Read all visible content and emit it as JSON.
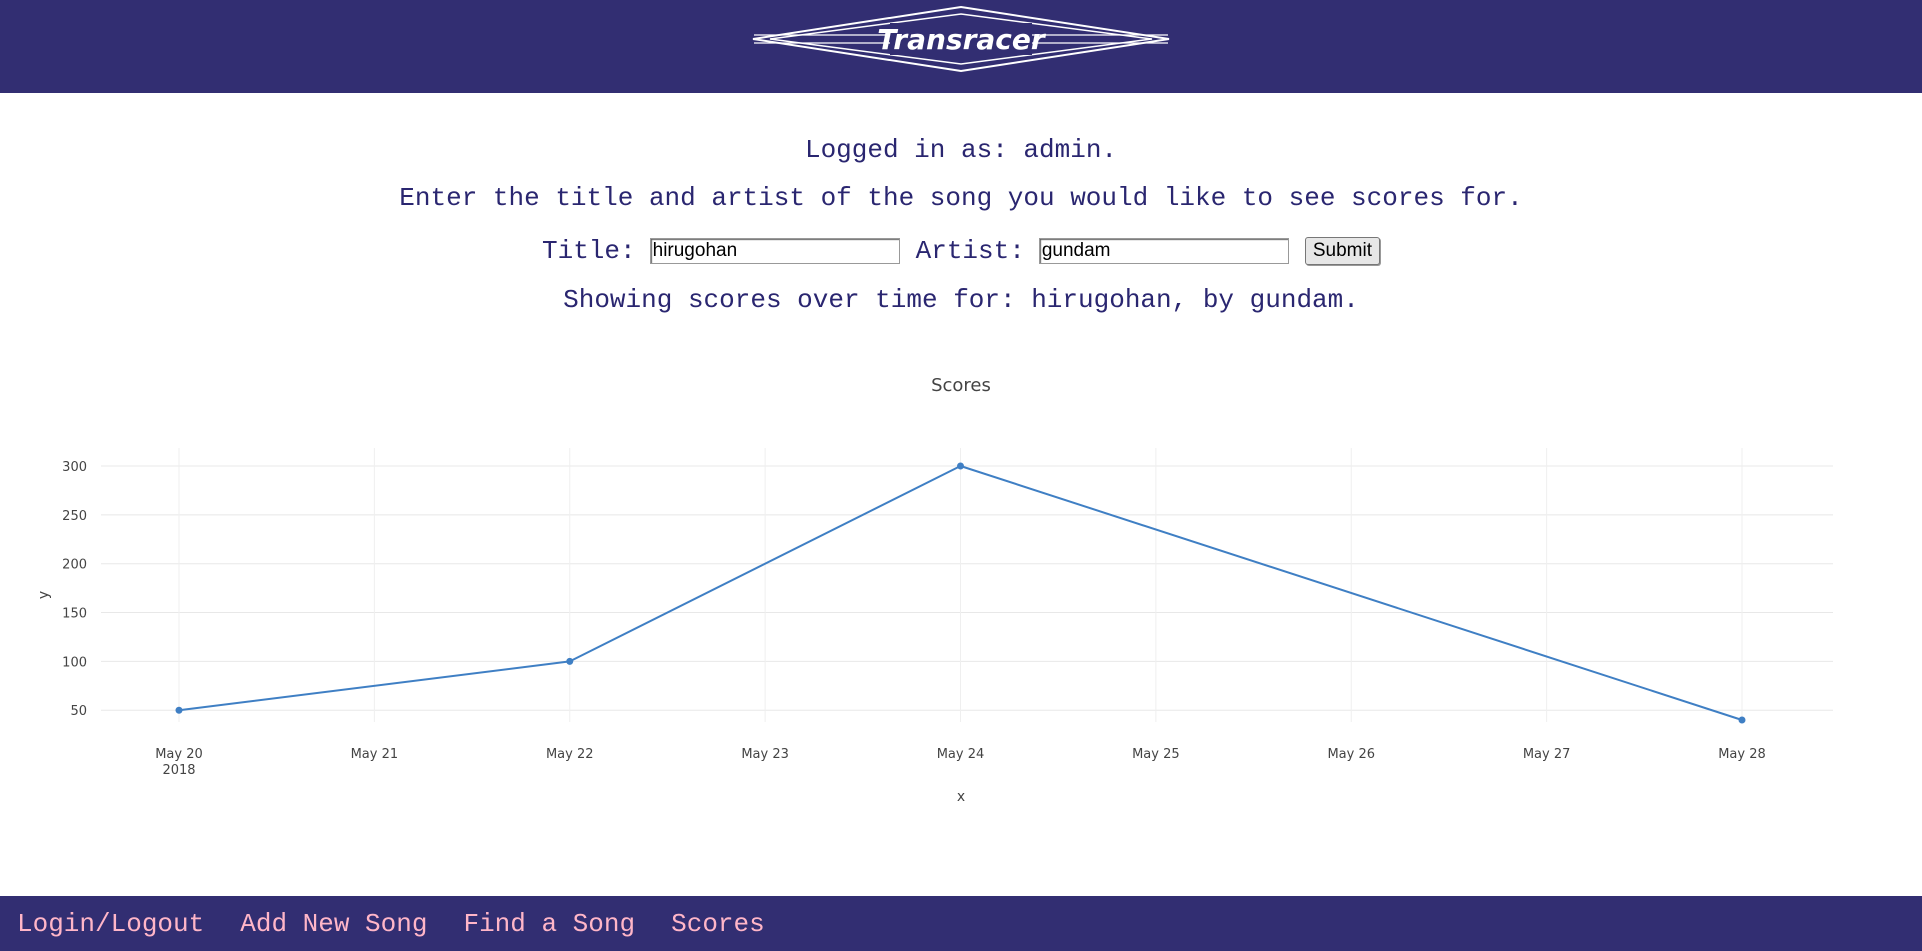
{
  "header": {
    "logo_text": "Transracer"
  },
  "status": {
    "logged_in_text": "Logged in as: admin.",
    "instruction": "Enter the title and artist of the song you would like to see scores for.",
    "showing_text": "Showing scores over time for: hirugohan, by gundam."
  },
  "form": {
    "title_label": "Title:",
    "title_value": "hirugohan",
    "artist_label": "Artist:",
    "artist_value": "gundam",
    "submit_label": "Submit"
  },
  "chart_data": {
    "type": "line",
    "title": "Scores",
    "xlabel": "x",
    "ylabel": "y",
    "x": [
      "2018-05-20",
      "2018-05-22",
      "2018-05-24",
      "2018-05-28"
    ],
    "y": [
      50,
      100,
      300,
      40
    ],
    "x_ticks": [
      "May 20",
      "May 21",
      "May 22",
      "May 23",
      "May 24",
      "May 25",
      "May 26",
      "May 27",
      "May 28"
    ],
    "x_tick_year": "2018",
    "y_ticks": [
      50,
      100,
      150,
      200,
      250,
      300
    ],
    "ylim": [
      40,
      300
    ],
    "grid": true,
    "line_color": "#3f7fc4"
  },
  "footer": {
    "nav": [
      {
        "label": "Login/Logout"
      },
      {
        "label": "Add New Song"
      },
      {
        "label": "Find a Song"
      },
      {
        "label": "Scores"
      }
    ]
  }
}
